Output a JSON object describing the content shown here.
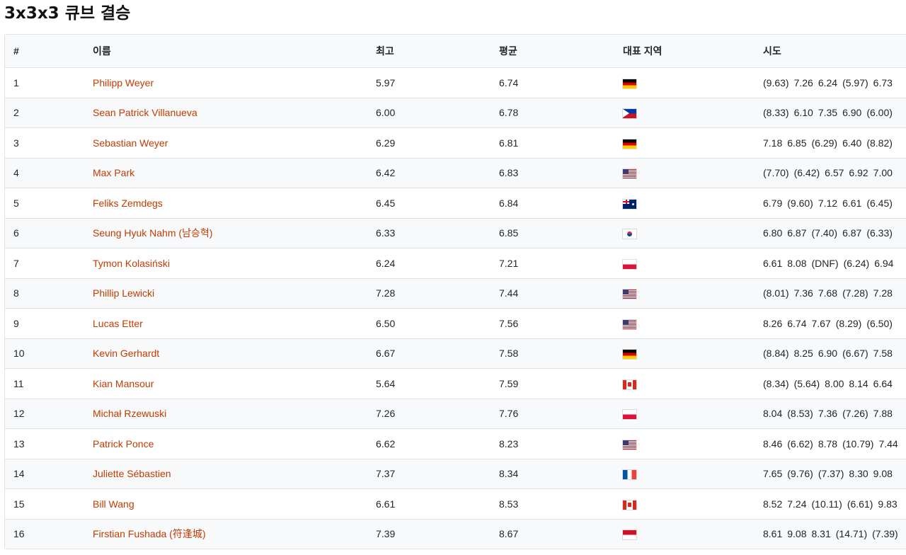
{
  "page": {
    "title": "3x3x3 큐브 결승"
  },
  "table": {
    "headers": {
      "rank": "#",
      "name": "이름",
      "best": "최고",
      "average": "평균",
      "region": "대표 지역",
      "solves": "시도"
    },
    "rows": [
      {
        "rank": "1",
        "name": "Philipp Weyer",
        "best": "5.97",
        "average": "6.74",
        "flag": "de",
        "solves": [
          "(9.63)",
          "7.26",
          "6.24",
          "(5.97)",
          "6.73"
        ]
      },
      {
        "rank": "2",
        "name": "Sean Patrick Villanueva",
        "best": "6.00",
        "average": "6.78",
        "flag": "ph",
        "solves": [
          "(8.33)",
          "6.10",
          "7.35",
          "6.90",
          "(6.00)"
        ]
      },
      {
        "rank": "3",
        "name": "Sebastian Weyer",
        "best": "6.29",
        "average": "6.81",
        "flag": "de",
        "solves": [
          "7.18",
          "6.85",
          "(6.29)",
          "6.40",
          "(8.82)"
        ]
      },
      {
        "rank": "4",
        "name": "Max Park",
        "best": "6.42",
        "average": "6.83",
        "flag": "us",
        "solves": [
          "(7.70)",
          "(6.42)",
          "6.57",
          "6.92",
          "7.00"
        ]
      },
      {
        "rank": "5",
        "name": "Feliks Zemdegs",
        "best": "6.45",
        "average": "6.84",
        "flag": "au",
        "solves": [
          "6.79",
          "(9.60)",
          "7.12",
          "6.61",
          "(6.45)"
        ]
      },
      {
        "rank": "6",
        "name": "Seung Hyuk Nahm (남승혁)",
        "best": "6.33",
        "average": "6.85",
        "flag": "kr",
        "solves": [
          "6.80",
          "6.87",
          "(7.40)",
          "6.87",
          "(6.33)"
        ]
      },
      {
        "rank": "7",
        "name": "Tymon Kolasiński",
        "best": "6.24",
        "average": "7.21",
        "flag": "pl",
        "solves": [
          "6.61",
          "8.08",
          "(DNF)",
          "(6.24)",
          "6.94"
        ]
      },
      {
        "rank": "8",
        "name": "Phillip Lewicki",
        "best": "7.28",
        "average": "7.44",
        "flag": "us",
        "solves": [
          "(8.01)",
          "7.36",
          "7.68",
          "(7.28)",
          "7.28"
        ]
      },
      {
        "rank": "9",
        "name": "Lucas Etter",
        "best": "6.50",
        "average": "7.56",
        "flag": "us",
        "solves": [
          "8.26",
          "6.74",
          "7.67",
          "(8.29)",
          "(6.50)"
        ]
      },
      {
        "rank": "10",
        "name": "Kevin Gerhardt",
        "best": "6.67",
        "average": "7.58",
        "flag": "de",
        "solves": [
          "(8.84)",
          "8.25",
          "6.90",
          "(6.67)",
          "7.58"
        ]
      },
      {
        "rank": "11",
        "name": "Kian Mansour",
        "best": "5.64",
        "average": "7.59",
        "flag": "ca",
        "solves": [
          "(8.34)",
          "(5.64)",
          "8.00",
          "8.14",
          "6.64"
        ]
      },
      {
        "rank": "12",
        "name": "Michał Rzewuski",
        "best": "7.26",
        "average": "7.76",
        "flag": "pl",
        "solves": [
          "8.04",
          "(8.53)",
          "7.36",
          "(7.26)",
          "7.88"
        ]
      },
      {
        "rank": "13",
        "name": "Patrick Ponce",
        "best": "6.62",
        "average": "8.23",
        "flag": "us",
        "solves": [
          "8.46",
          "(6.62)",
          "8.78",
          "(10.79)",
          "7.44"
        ]
      },
      {
        "rank": "14",
        "name": "Juliette Sébastien",
        "best": "7.37",
        "average": "8.34",
        "flag": "fr",
        "solves": [
          "7.65",
          "(9.76)",
          "(7.37)",
          "8.30",
          "9.08"
        ]
      },
      {
        "rank": "15",
        "name": "Bill Wang",
        "best": "6.61",
        "average": "8.53",
        "flag": "ca",
        "solves": [
          "8.52",
          "7.24",
          "(10.11)",
          "(6.61)",
          "9.83"
        ]
      },
      {
        "rank": "16",
        "name": "Firstian Fushada (符逢城)",
        "best": "7.39",
        "average": "8.67",
        "flag": "id",
        "solves": [
          "8.61",
          "9.08",
          "8.31",
          "(14.71)",
          "(7.39)"
        ]
      }
    ]
  },
  "colors": {
    "link": "#c03c00",
    "border": "#dee2e6",
    "stripe": "#f8f9fa"
  }
}
